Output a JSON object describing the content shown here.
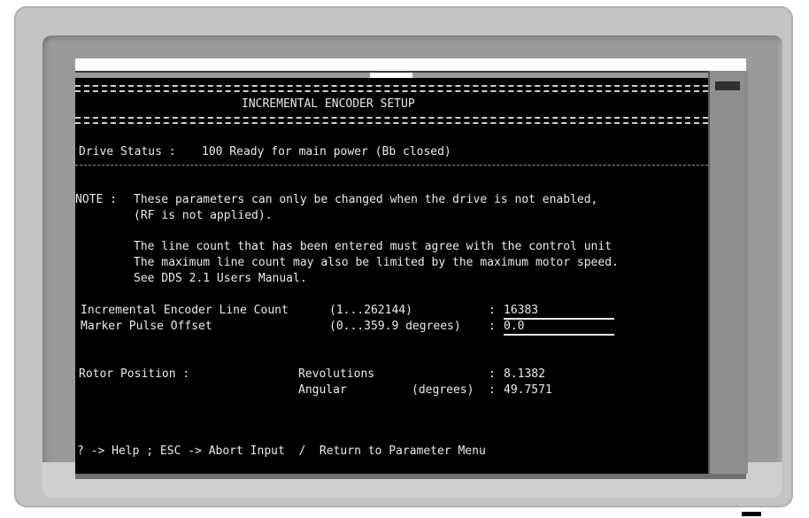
{
  "screen": {
    "title": "INCREMENTAL ENCODER SETUP",
    "drive_status_label": "Drive Status :",
    "drive_status_value": "100 Ready for main power (Bb closed)",
    "note_prefix": "NOTE :",
    "note_lines": [
      "These parameters can only be changed when the drive is not enabled,",
      "(RF is not applied).",
      "The line count that has been entered must agree with the control unit",
      "The maximum line count may also be limited by the maximum motor speed.",
      "See DDS 2.1 Users Manual."
    ],
    "fields": [
      {
        "label": "Incremental Encoder Line Count",
        "range": "(1...262144)",
        "value": "16383"
      },
      {
        "label": "Marker Pulse Offset",
        "range": "(0...359.9 degrees)",
        "value": "0.0"
      }
    ],
    "rotor": {
      "label": "Rotor Position :",
      "revolutions_label": "Revolutions",
      "revolutions_value": "8.1382",
      "angular_label": "Angular",
      "angular_unit": "(degrees)",
      "angular_value": "49.7571"
    },
    "footer": "? -> Help ; ESC -> Abort Input  /  Return to Parameter Menu"
  },
  "colors": {
    "screen_bg": "#000000",
    "screen_fg": "#eaeaea",
    "bezel": "#c4c4c4"
  }
}
